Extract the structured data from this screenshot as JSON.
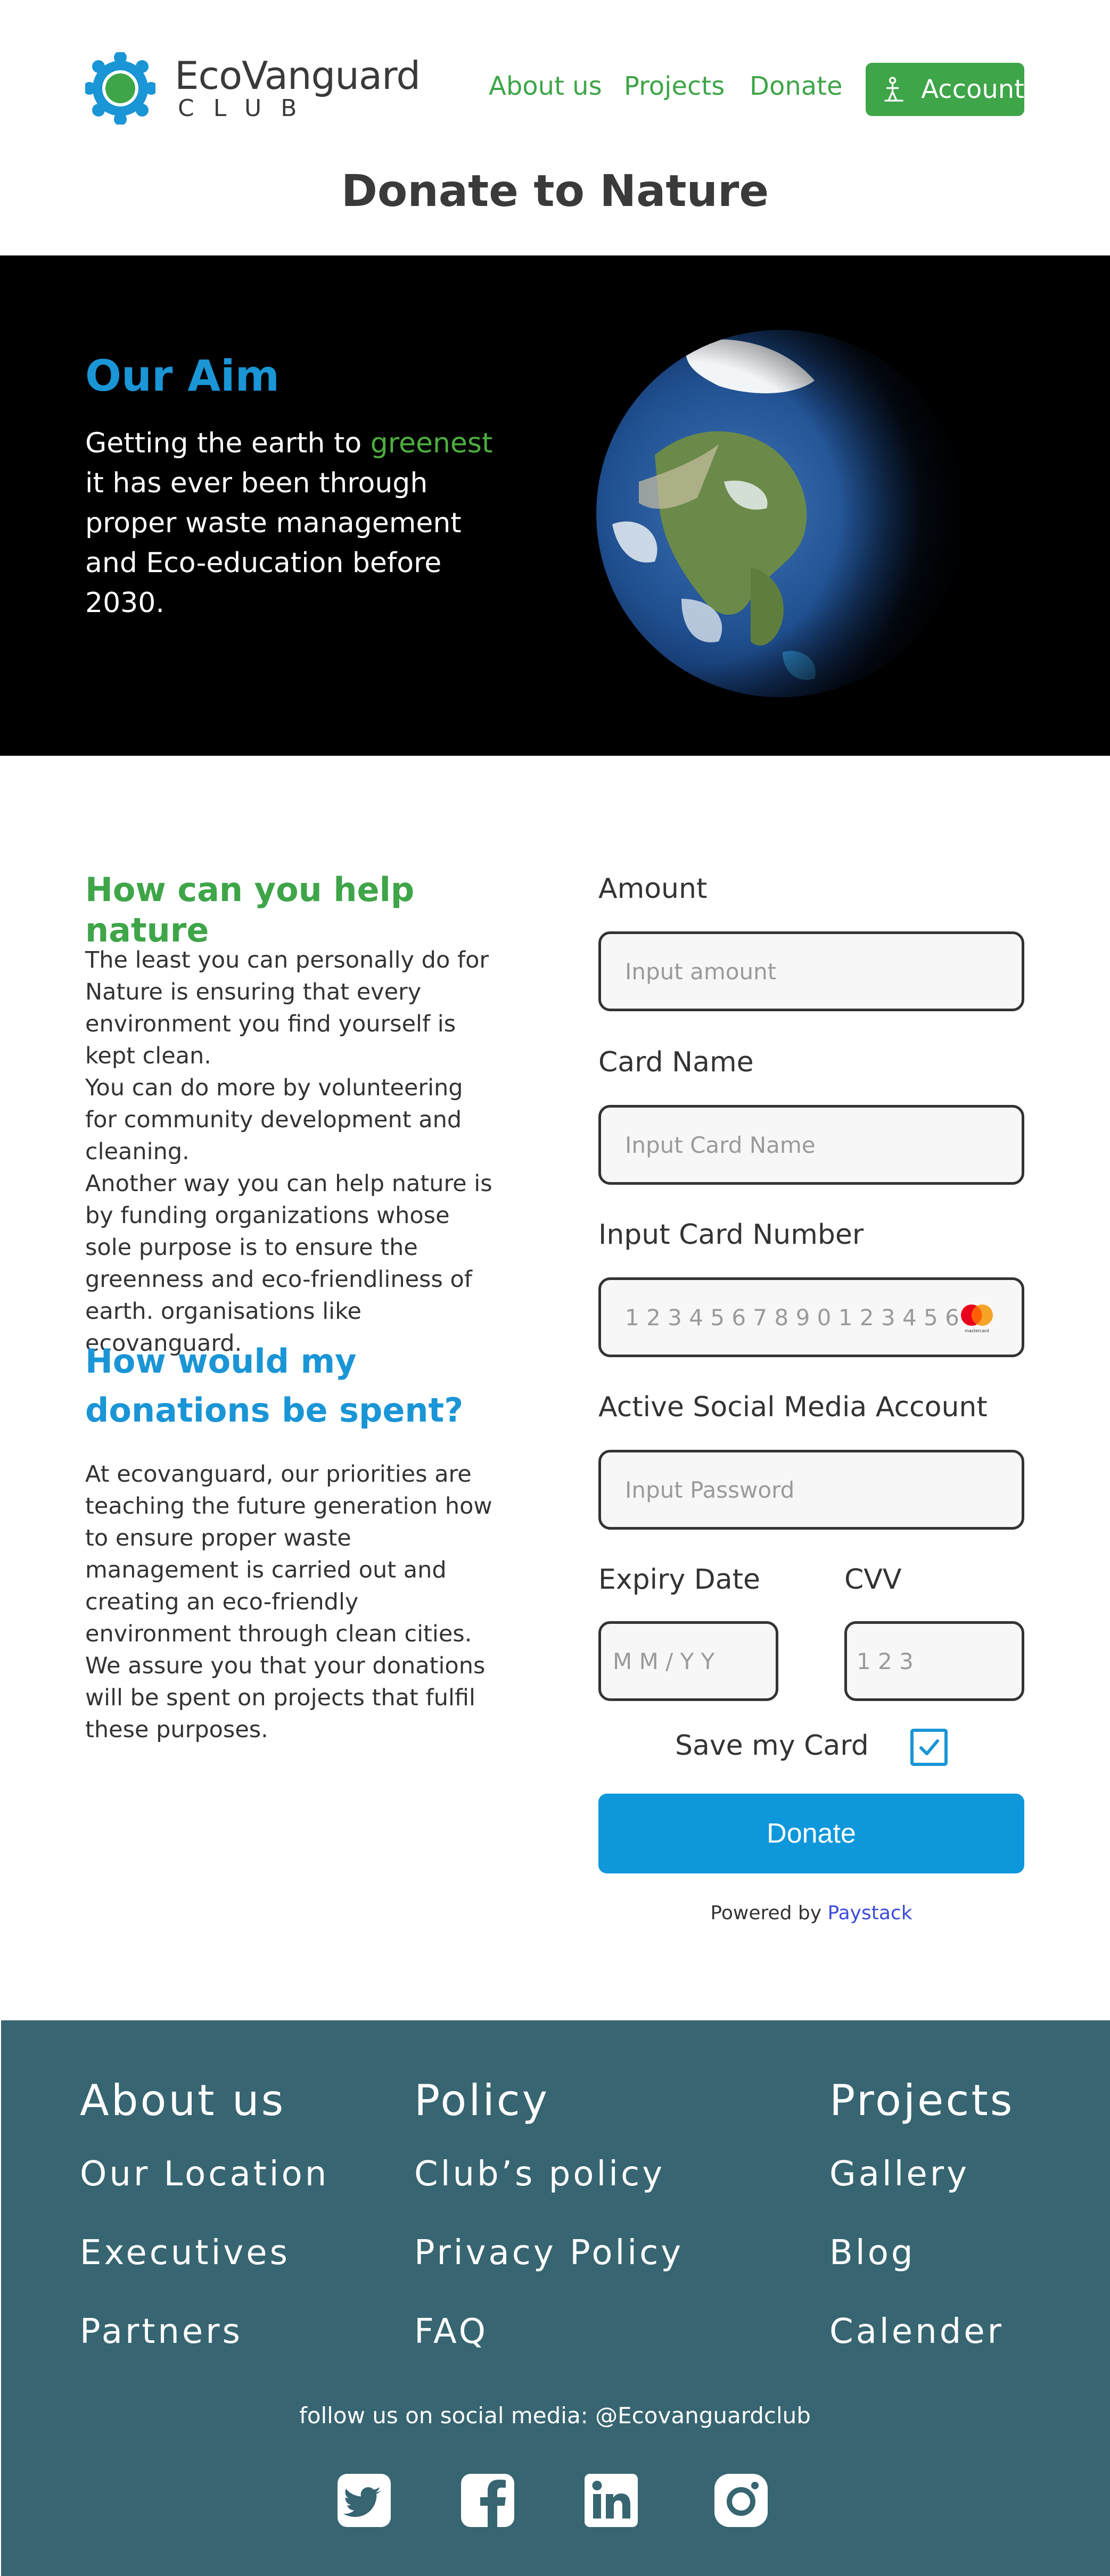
{
  "header": {
    "brand_name": "EcoVanguard",
    "brand_sub": "CLUB",
    "nav": [
      "About us",
      "Projects",
      "Donate"
    ],
    "account_label": "Account",
    "page_title": "Donate to Nature"
  },
  "hero": {
    "title": "Our Aim",
    "text_before": "Getting the earth to ",
    "text_highlight": "greenest",
    "text_after": " it has ever been through proper waste management and Eco-education before 2030."
  },
  "help": {
    "title": "How can you help nature",
    "paragraphs": [
      "The least you can personally do for Nature is ensuring that every environment you find yourself is kept clean.",
      "You can do more by volunteering for community development and cleaning.",
      "Another way you can help nature is by funding organizations whose sole purpose is to ensure the greenness and eco-friendliness of earth. organisations like ecovanguard."
    ]
  },
  "spent": {
    "title": "How would my donations be spent?",
    "paragraphs": [
      "At ecovanguard, our priorities are teaching the future generation how to ensure proper waste management is carried out and creating an eco-friendly environment through clean cities.",
      "We assure you that your donations will be spent on projects that fulfil these purposes."
    ]
  },
  "form": {
    "amount_label": "Amount",
    "amount_placeholder": "Input amount",
    "card_name_label": "Card Name",
    "card_name_placeholder": "Input Card Name",
    "card_number_label": "Input Card Number",
    "card_number_placeholder": "1 2 3 4  5 6 7 8  9 0 1 2  3 4 5 6",
    "social_label": "Active Social Media Account",
    "social_placeholder": "Input Password",
    "expiry_label": "Expiry Date",
    "expiry_placeholder": "M M /  Y Y",
    "cvv_label": "CVV",
    "cvv_placeholder": "1 2 3",
    "save_card_label": "Save my Card",
    "save_card_checked": true,
    "donate_label": "Donate",
    "powered_by": "Powered by ",
    "powered_brand": "Paystack",
    "card_brand_text": "mastercard"
  },
  "footer": {
    "columns": [
      {
        "title": "About us",
        "links": [
          "Our Location",
          "Executives",
          "Partners"
        ]
      },
      {
        "title": "Policy",
        "links": [
          "Club’s policy",
          "Privacy Policy",
          "FAQ"
        ]
      },
      {
        "title": "Projects",
        "links": [
          "Gallery",
          "Blog",
          "Calender"
        ]
      }
    ],
    "follow_text": "follow us on social media: @Ecovanguardclub",
    "social_icons": [
      "twitter-icon",
      "facebook-icon",
      "linkedin-icon",
      "instagram-icon"
    ]
  },
  "colors": {
    "brand_green": "#3ea548",
    "brand_blue": "#1a95d6",
    "donate_blue": "#0f97dc",
    "footer_bg": "#376571",
    "hero_bg": "#000000"
  }
}
